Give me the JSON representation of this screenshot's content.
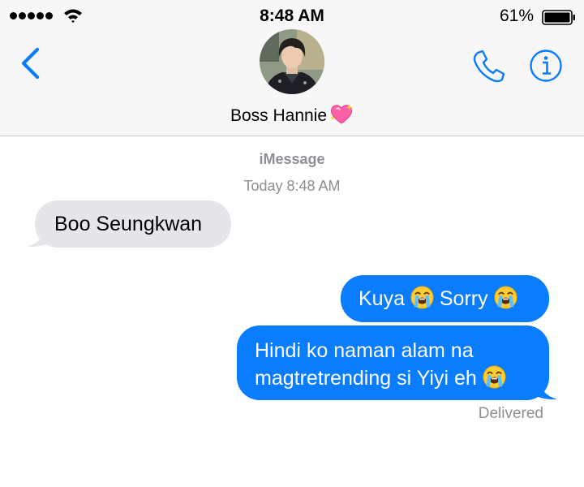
{
  "status_bar": {
    "time": "8:48 AM",
    "battery_percent": "61%",
    "signal_bars": 5,
    "battery_level": 0.61,
    "icons": [
      "signal-dots-icon",
      "wifi-icon",
      "battery-icon"
    ]
  },
  "header": {
    "contact_name": "Boss Hannie",
    "name_emoji": "sparkling-heart",
    "back_icon": "chevron-left-icon",
    "call_icon": "phone-icon",
    "info_icon": "info-icon"
  },
  "conversation": {
    "service": "iMessage",
    "timestamp": "Today 8:48 AM",
    "messages": [
      {
        "direction": "received",
        "parts": [
          "Boo Seungkwan"
        ]
      },
      {
        "direction": "sent",
        "parts": [
          "Kuya ",
          "loudly-crying-face",
          " Sorry ",
          "loudly-crying-face"
        ]
      },
      {
        "direction": "sent",
        "lines": [
          "Hindi ko naman alam na",
          "magtretrending si Yiyi eh "
        ],
        "trailing_emoji": "loudly-crying-face"
      }
    ],
    "delivery_status": "Delivered"
  },
  "colors": {
    "accent": "#0a7cff",
    "received_bubble": "#e5e5ea",
    "secondary_text": "#8e8e93",
    "header_bg": "#f7f7f7"
  },
  "text": {
    "m1": "Boo Seungkwan",
    "m2a": "Kuya ",
    "m2b": " Sorry ",
    "m3a": "Hindi ko naman alam na",
    "m3b": "magtretrending si Yiyi eh "
  }
}
